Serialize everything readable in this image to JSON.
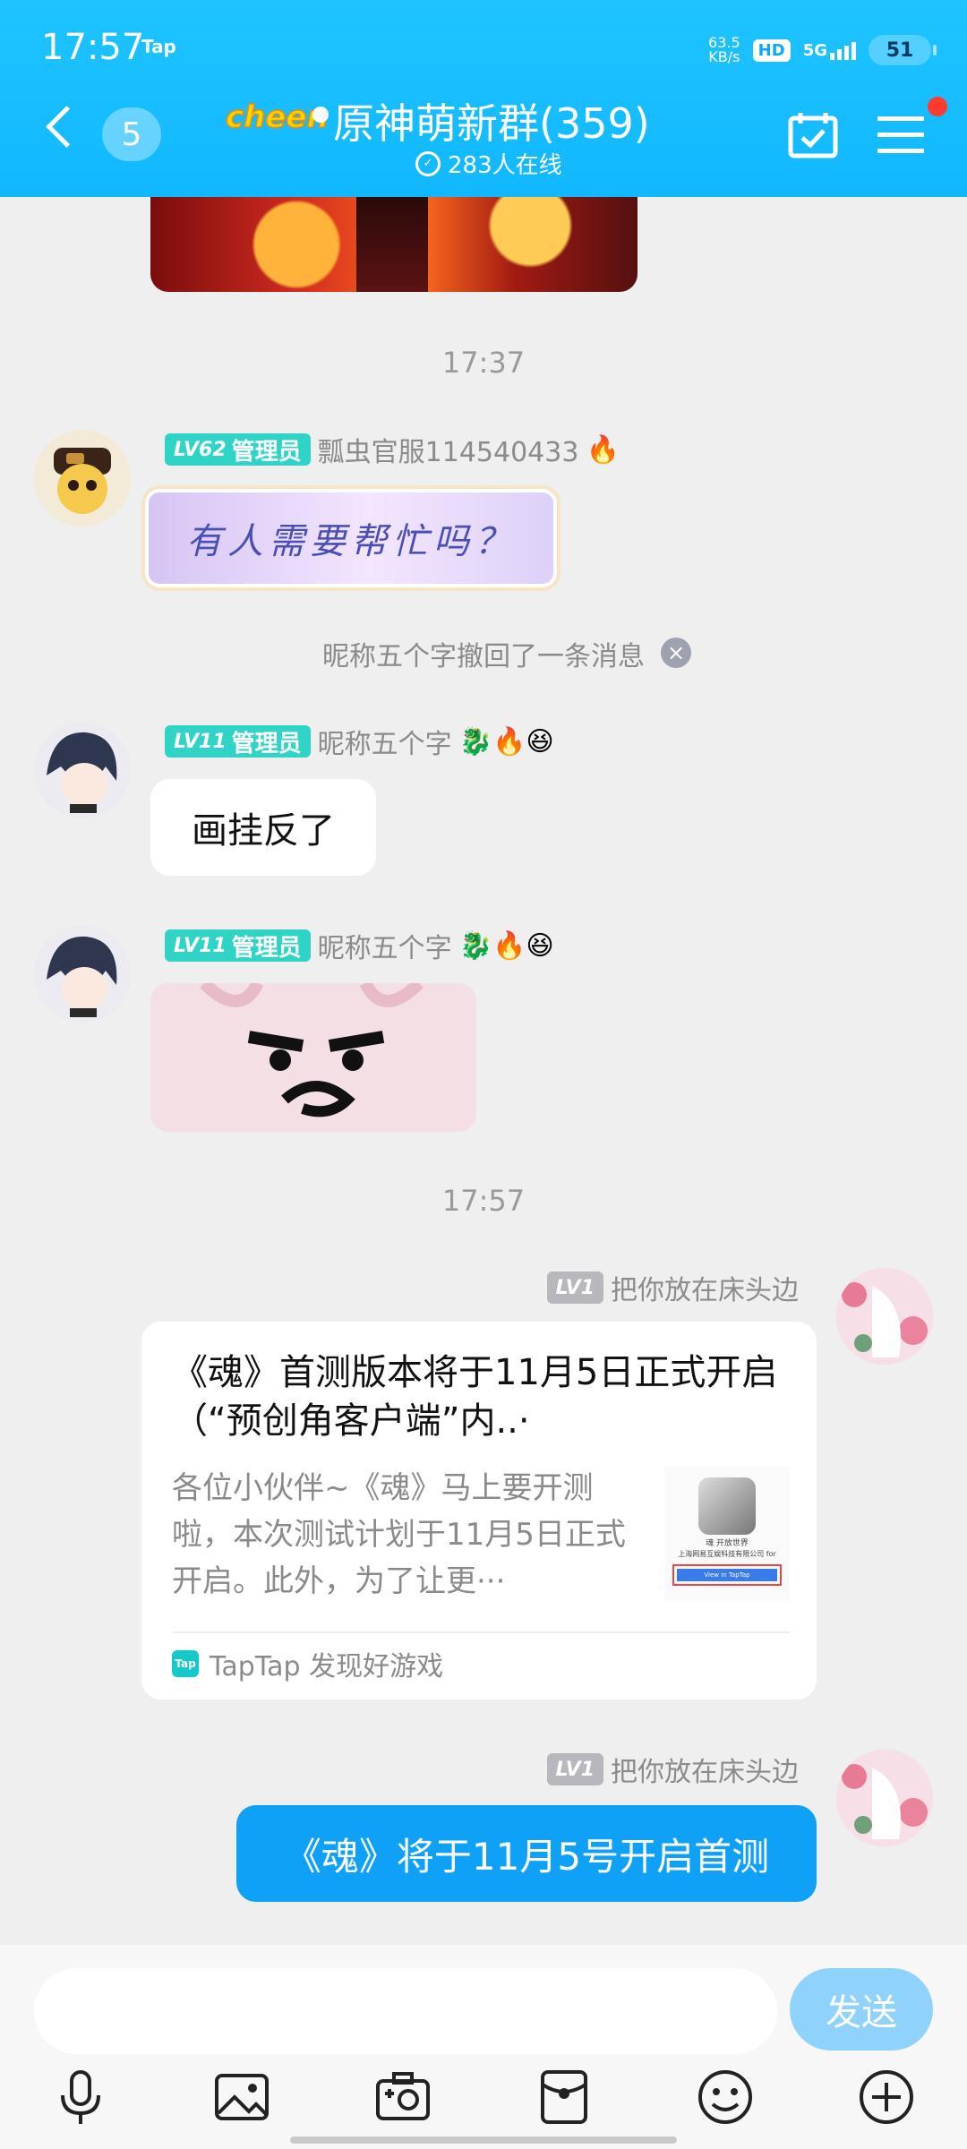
{
  "status_bar": {
    "time": "17:57",
    "app_tag": "Tap",
    "net_speed_value": "63.5",
    "net_speed_unit": "KB/s",
    "hd": "HD",
    "network": "5G",
    "battery": "51"
  },
  "header": {
    "back_badge": "5",
    "brand_logo": "cheen",
    "title": "原神萌新群(359)",
    "online": "283人在线",
    "icons": [
      "back-arrow-icon",
      "calendar-check-icon",
      "menu-icon"
    ]
  },
  "messages": {
    "time_1": "17:37",
    "msg1": {
      "level": "LV62",
      "role": "管理员",
      "name": "瓢虫官服114540433",
      "name_emoji": "🔥",
      "sticker_text": "有人需要帮忙吗？"
    },
    "recall": "昵称五个字撤回了一条消息",
    "msg2": {
      "level": "LV11",
      "role": "管理员",
      "name": "昵称五个字",
      "emojis": "🐉🔥😆",
      "text": "画挂反了"
    },
    "msg3": {
      "level": "LV11",
      "role": "管理员",
      "name": "昵称五个字",
      "emojis": "🐉🔥😆"
    },
    "time_2": "17:57",
    "msg4": {
      "level": "LV1",
      "name": "把你放在床头边",
      "card_title": "《魂》首测版本将于11月5日正式开启（“预创角客户端”内..·",
      "card_desc": "各位小伙伴~《魂》马上要开测啦，本次测试计划于11月5日正式开启。此外，为了让更···",
      "card_source": "TapTap 发现好游戏",
      "thumb_line1": "魂 开放世界",
      "thumb_line2": "上海网易互娱科技有限公司 for",
      "thumb_button": "View in TapTap"
    },
    "msg5": {
      "level": "LV1",
      "name": "把你放在床头边",
      "text": "《魂》将于11月5号开启首测"
    }
  },
  "input": {
    "placeholder": "",
    "send_label": "发送"
  },
  "toolbar": [
    "microphone-icon",
    "image-icon",
    "camera-icon",
    "red-packet-icon",
    "emoji-icon",
    "plus-icon"
  ]
}
